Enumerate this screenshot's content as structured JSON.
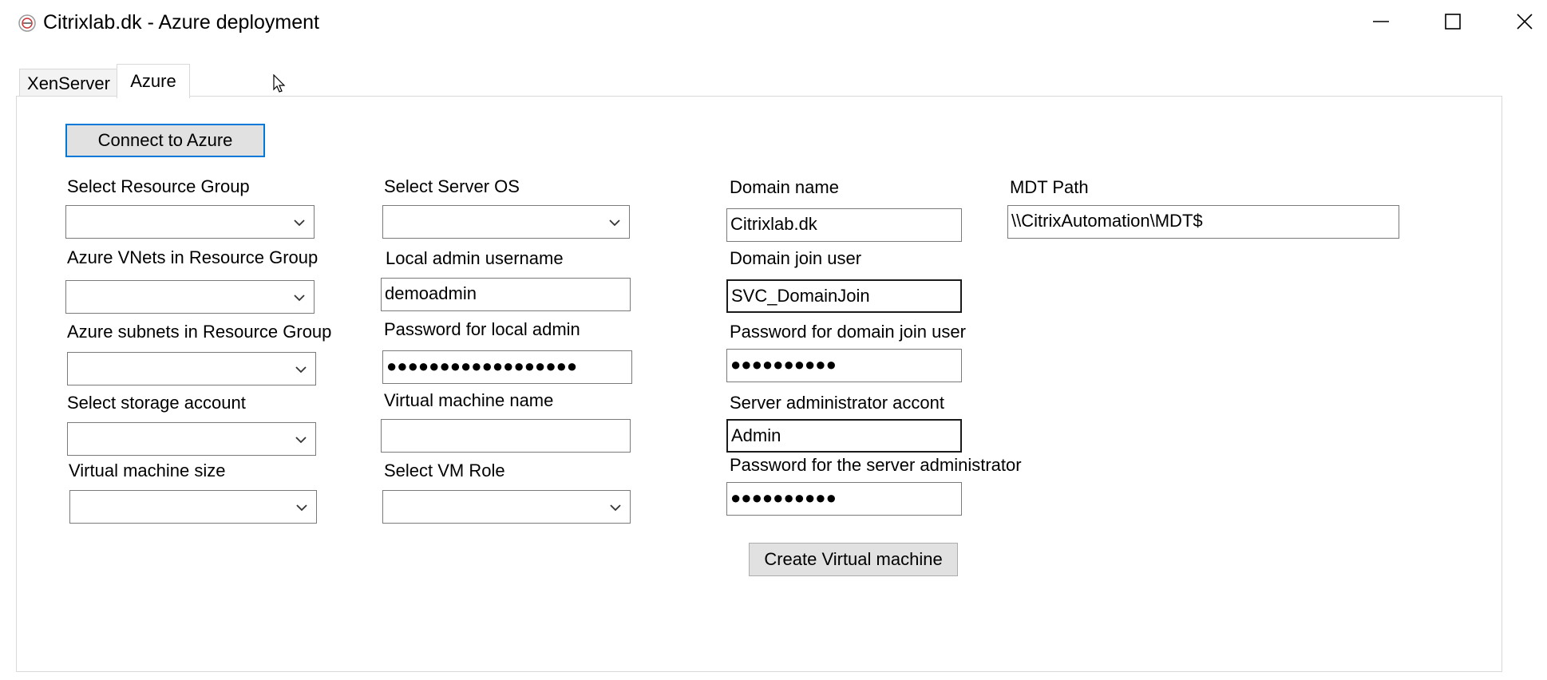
{
  "window": {
    "title": "Citrixlab.dk - Azure deployment",
    "icon": "app-logo-icon",
    "controls": [
      "minimize-icon",
      "maximize-icon",
      "close-icon"
    ]
  },
  "tabs": [
    {
      "label": "XenServer",
      "selected": false
    },
    {
      "label": "Azure",
      "selected": true
    }
  ],
  "buttons": {
    "connect": "Connect to Azure",
    "create_vm": "Create Virtual machine"
  },
  "column1": {
    "resource_group_label": "Select Resource Group",
    "resource_group_value": "",
    "vnets_label": "Azure VNets in Resource Group",
    "vnets_value": "",
    "subnets_label": "Azure subnets in Resource Group",
    "subnets_value": "",
    "storage_label": "Select storage account",
    "storage_value": "",
    "vm_size_label": "Virtual machine size",
    "vm_size_value": ""
  },
  "column2": {
    "server_os_label": "Select Server OS",
    "server_os_value": "",
    "local_admin_label": "Local admin username",
    "local_admin_value": "demoadmin",
    "local_admin_pw_label": "Password for local admin",
    "local_admin_pw_value": "●●●●●●●●●●●●●●●●●●",
    "vm_name_label": "Virtual machine name",
    "vm_name_value": "",
    "vm_role_label": "Select VM Role",
    "vm_role_value": ""
  },
  "column3": {
    "domain_name_label": "Domain name",
    "domain_name_value": "Citrixlab.dk",
    "domain_join_user_label": "Domain join user",
    "domain_join_user_value": "SVC_DomainJoin",
    "domain_join_pw_label": "Password for domain join user",
    "domain_join_pw_value": "●●●●●●●●●●",
    "server_admin_label": "Server administrator accont",
    "server_admin_value": "Admin",
    "server_admin_pw_label": "Password for the server administrator",
    "server_admin_pw_value": "●●●●●●●●●●"
  },
  "column4": {
    "mdt_path_label": "MDT Path",
    "mdt_path_value": "\\\\CitrixAutomation\\MDT$"
  }
}
